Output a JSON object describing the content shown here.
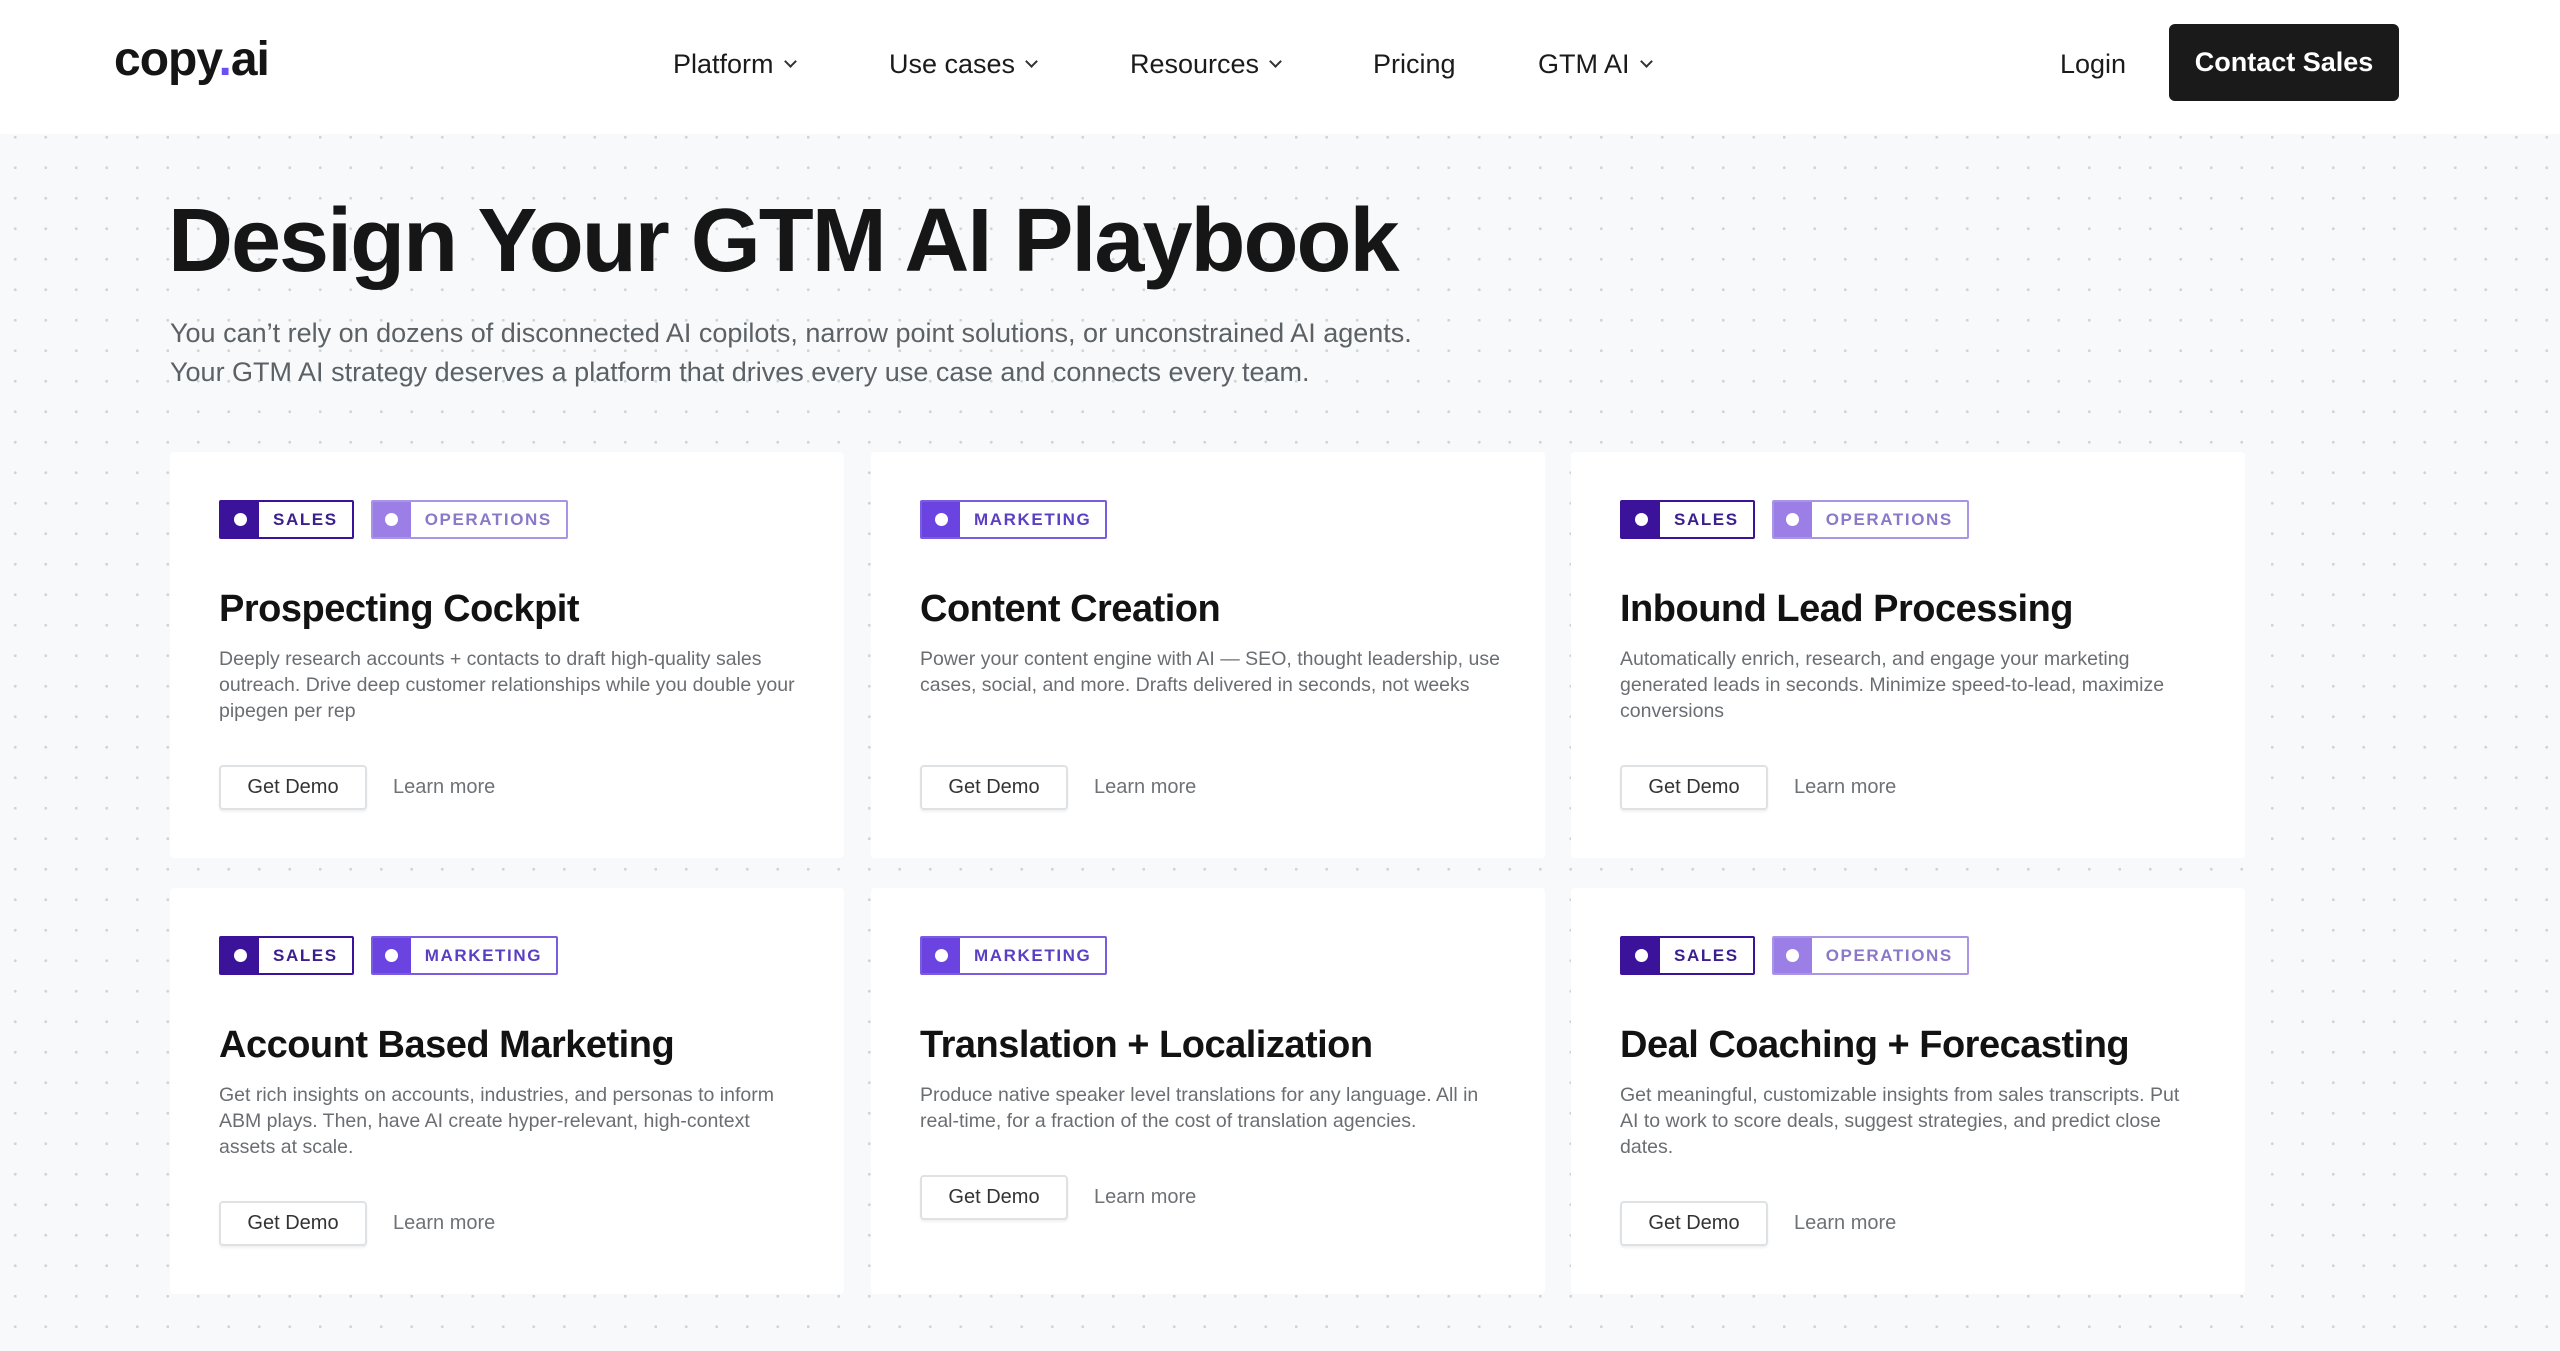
{
  "header": {
    "logo": {
      "main": "copy",
      "dot": ".",
      "suffix": "ai"
    },
    "nav": [
      {
        "label": "Platform",
        "has_dropdown": true,
        "icon": "chevron-down-icon"
      },
      {
        "label": "Use cases",
        "has_dropdown": true,
        "icon": "chevron-down-icon"
      },
      {
        "label": "Resources",
        "has_dropdown": true,
        "icon": "chevron-down-icon"
      },
      {
        "label": "Pricing",
        "has_dropdown": false
      },
      {
        "label": "GTM AI",
        "has_dropdown": true,
        "icon": "chevron-down-icon"
      }
    ],
    "login_label": "Login",
    "contact_label": "Contact Sales"
  },
  "hero": {
    "title": "Design Your GTM AI Playbook",
    "subtitle_line1": "You can’t rely on dozens of disconnected AI copilots, narrow point solutions, or unconstrained AI agents.",
    "subtitle_line2": "Your GTM AI strategy deserves a platform that drives every use case and connects every team."
  },
  "tag_styles": {
    "SALES": {
      "swatch": "#3b139a",
      "border": "#3b139a",
      "text": "#3b1f8c"
    },
    "OPERATIONS": {
      "swatch": "#9b7fe6",
      "border": "#a995e6",
      "text": "#8b78c8"
    },
    "MARKETING": {
      "swatch": "#6a43e0",
      "border": "#7a5ce0",
      "text": "#5b3fc2"
    }
  },
  "cards": [
    {
      "tags": [
        "SALES",
        "OPERATIONS"
      ],
      "title": "Prospecting Cockpit",
      "description": "Deeply research accounts + contacts to draft high-quality sales outreach. Drive deep customer relationships while you double your pipegen per rep",
      "demo_label": "Get Demo",
      "learn_label": "Learn more"
    },
    {
      "tags": [
        "MARKETING"
      ],
      "title": "Content Creation",
      "description": "Power your content engine with AI — SEO, thought leadership, use cases, social, and more. Drafts delivered in seconds, not weeks",
      "demo_label": "Get Demo",
      "learn_label": "Learn more"
    },
    {
      "tags": [
        "SALES",
        "OPERATIONS"
      ],
      "title": "Inbound Lead Processing",
      "description": "Automatically enrich, research, and engage your marketing generated leads in seconds. Minimize speed-to-lead, maximize conversions",
      "demo_label": "Get Demo",
      "learn_label": "Learn more"
    },
    {
      "tags": [
        "SALES",
        "MARKETING"
      ],
      "title": "Account Based Marketing",
      "description": "Get rich insights on accounts, industries, and personas to inform ABM plays. Then, have AI create hyper-relevant, high-context assets at scale.",
      "demo_label": "Get Demo",
      "learn_label": "Learn more"
    },
    {
      "tags": [
        "MARKETING"
      ],
      "title": "Translation + Localization",
      "description": "Produce native speaker level translations for any language. All in real-time, for a fraction of the cost of translation agencies.",
      "demo_label": "Get Demo",
      "learn_label": "Learn more"
    },
    {
      "tags": [
        "SALES",
        "OPERATIONS"
      ],
      "title": "Deal Coaching + Forecasting",
      "description": "Get meaningful, customizable insights from sales transcripts. Put AI to work to score deals, suggest strategies, and predict close dates.",
      "demo_label": "Get Demo",
      "learn_label": "Learn more"
    }
  ]
}
